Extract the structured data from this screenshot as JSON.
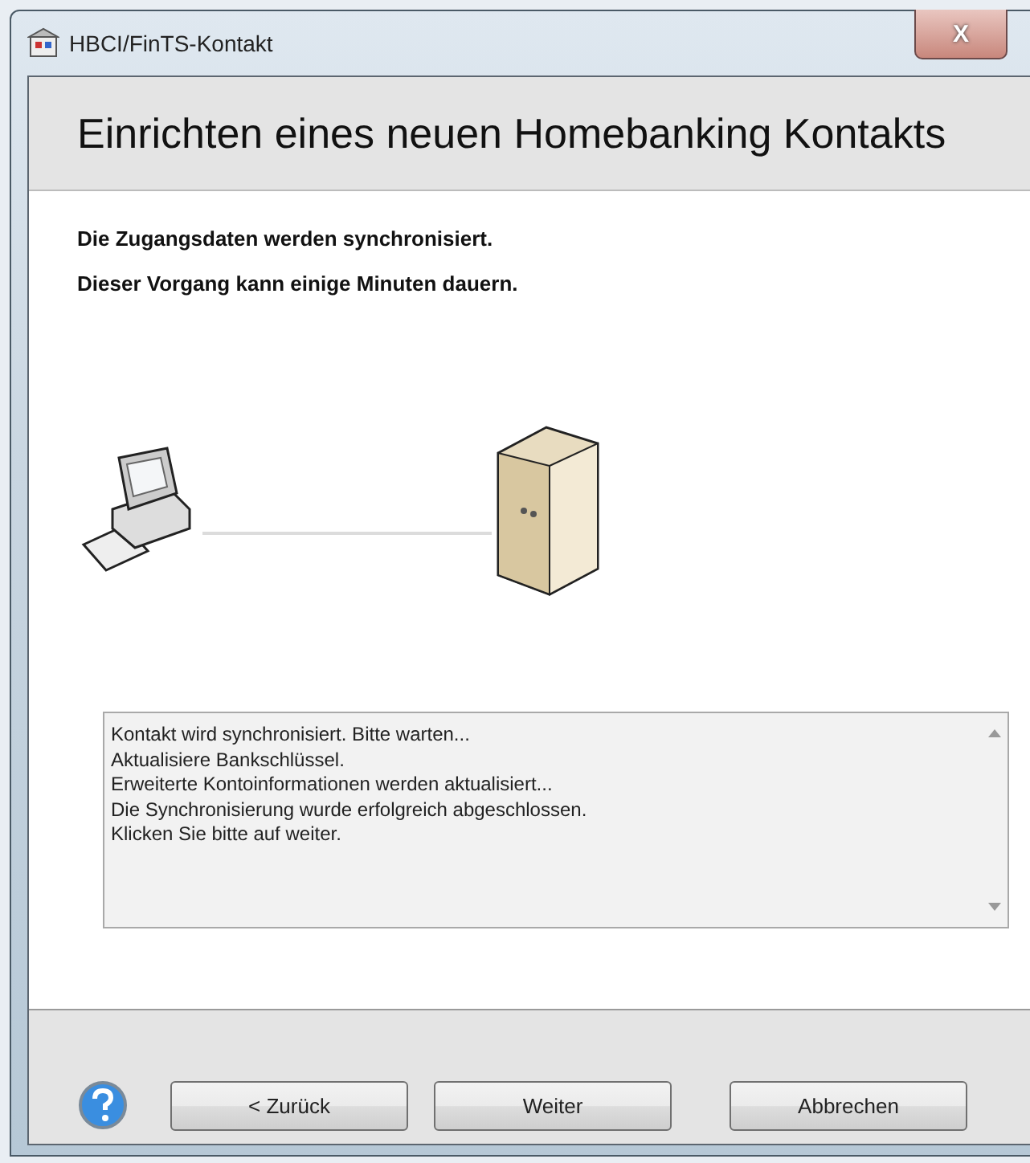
{
  "window": {
    "title": "HBCI/FinTS-Kontakt",
    "close": "X"
  },
  "header": {
    "title": "Einrichten eines neuen Homebanking Kontakts"
  },
  "intro": [
    "Die Zugangsdaten werden synchronisiert.",
    "Dieser Vorgang kann einige Minuten dauern."
  ],
  "log": [
    "Kontakt wird synchronisiert. Bitte warten...",
    "Aktualisiere Bankschlüssel.",
    "Erweiterte Kontoinformationen werden aktualisiert...",
    "Die Synchronisierung wurde erfolgreich abgeschlossen.",
    "Klicken Sie bitte auf weiter."
  ],
  "buttons": [
    {
      "label": "< Zurück"
    },
    {
      "label": "Weiter"
    },
    {
      "label": "Abbrechen"
    }
  ]
}
